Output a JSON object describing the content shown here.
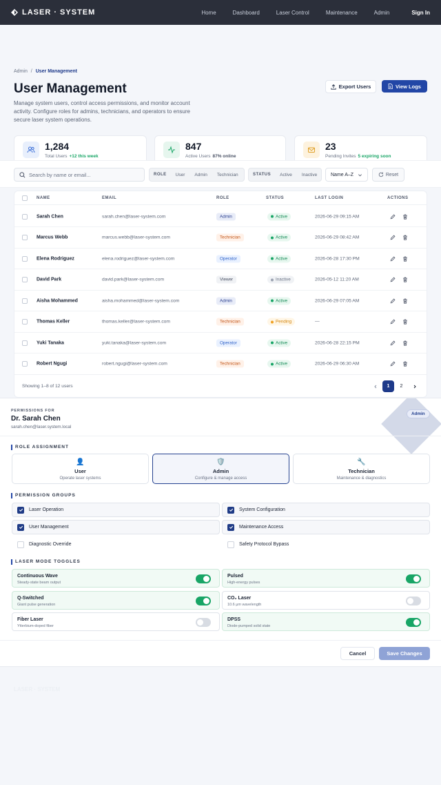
{
  "nav": {
    "brand": "LASER · SYSTEM",
    "links": [
      "Home",
      "Dashboard",
      "Laser Control",
      "Maintenance",
      "Admin"
    ],
    "signin": "Sign In"
  },
  "header": {
    "breadcrumb_root": "Admin",
    "breadcrumb_sep": "/",
    "breadcrumb_current": "User Management",
    "title": "User Management",
    "description": "Manage system users, control access permissions, and monitor account activity. Configure roles for admins, technicians, and operators to ensure secure laser system operations.",
    "export_label": "Export Users",
    "logs_label": "View Logs"
  },
  "stats": [
    {
      "value": "1,284",
      "label": "Total Users",
      "delta": "+12 this week",
      "color": "#3b6fd8"
    },
    {
      "value": "847",
      "label": "Active Users",
      "delta": "87% online",
      "color": "#18a566"
    },
    {
      "value": "23",
      "label": "Pending Invites",
      "delta": "5 expiring soon",
      "color": "#e0a028"
    }
  ],
  "filters": {
    "search_placeholder": "Search by name or email...",
    "role_label": "ROLE",
    "role_options": [
      "User",
      "Admin",
      "Technician"
    ],
    "status_label": "STATUS",
    "status_options": [
      "Active",
      "Inactive"
    ],
    "sort": "Name A–Z",
    "reset": "Reset"
  },
  "table": {
    "headers": {
      "name": "NAME",
      "email": "EMAIL",
      "role": "ROLE",
      "status": "STATUS",
      "last_login": "LAST LOGIN",
      "actions": "ACTIONS"
    },
    "rows": [
      {
        "name": "Sarah Chen",
        "email": "sarah.chen@laser-system.com",
        "role": "Admin",
        "status": "Active",
        "last_login": "2026-06-29 09:15 AM"
      },
      {
        "name": "Marcus Webb",
        "email": "marcus.webb@laser-system.com",
        "role": "Technician",
        "status": "Active",
        "last_login": "2026-06-29 08:42 AM"
      },
      {
        "name": "Elena Rodriguez",
        "email": "elena.rodriguez@laser-system.com",
        "role": "Operator",
        "status": "Active",
        "last_login": "2026-06-28 17:30 PM"
      },
      {
        "name": "David Park",
        "email": "david.park@laser-system.com",
        "role": "Viewer",
        "status": "Inactive",
        "last_login": "2026-05-12 11:20 AM"
      },
      {
        "name": "Aisha Mohammed",
        "email": "aisha.mohammed@laser-system.com",
        "role": "Admin",
        "status": "Active",
        "last_login": "2026-06-29 07:05 AM"
      },
      {
        "name": "Thomas Keller",
        "email": "thomas.keller@laser-system.com",
        "role": "Technician",
        "status": "Pending",
        "last_login": "—"
      },
      {
        "name": "Yuki Tanaka",
        "email": "yuki.tanaka@laser-system.com",
        "role": "Operator",
        "status": "Active",
        "last_login": "2026-06-28 22:15 PM"
      },
      {
        "name": "Robert Ngugi",
        "email": "robert.ngugi@laser-system.com",
        "role": "Technician",
        "status": "Active",
        "last_login": "2026-06-29 06:30 AM"
      }
    ],
    "showing": "Showing 1–8 of 12 users",
    "pages": [
      "1",
      "2"
    ],
    "current_page": "1"
  },
  "permissions": {
    "eyebrow": "PERMISSIONS FOR",
    "name": "Dr. Sarah Chen",
    "email": "sarah.chen@laser.system.local",
    "badge": "Admin",
    "role_section": "ROLE ASSIGNMENT",
    "roles": [
      {
        "title": "User",
        "desc": "Operate laser systems",
        "emoji": "👤",
        "selected": false
      },
      {
        "title": "Admin",
        "desc": "Configure & manage access",
        "emoji": "🛡️",
        "selected": true
      },
      {
        "title": "Technician",
        "desc": "Maintenance & diagnostics",
        "emoji": "🔧",
        "selected": false
      }
    ],
    "groups_section": "PERMISSION GROUPS",
    "groups": [
      {
        "label": "Laser Operation",
        "checked": true
      },
      {
        "label": "System Configuration",
        "checked": true
      },
      {
        "label": "User Management",
        "checked": true
      },
      {
        "label": "Maintenance Access",
        "checked": true
      },
      {
        "label": "Diagnostic Override",
        "checked": false
      },
      {
        "label": "Safety Protocol Bypass",
        "checked": false
      }
    ],
    "toggles_section": "LASER MODE TOGGLES",
    "toggles": [
      {
        "title": "Continuous Wave",
        "desc": "Steady-state beam output",
        "on": true
      },
      {
        "title": "Pulsed",
        "desc": "High-energy pulses",
        "on": true
      },
      {
        "title": "Q-Switched",
        "desc": "Giant pulse generation",
        "on": true
      },
      {
        "title": "CO₂ Laser",
        "desc": "10.6 μm wavelength",
        "on": false
      },
      {
        "title": "Fiber Laser",
        "desc": "Ytterbium-doped fiber",
        "on": false
      },
      {
        "title": "DPSS",
        "desc": "Diode-pumped solid state",
        "on": true
      }
    ],
    "cancel": "Cancel",
    "save": "Save Changes"
  },
  "footer": {
    "brand": "LASER · SYSTEM"
  }
}
